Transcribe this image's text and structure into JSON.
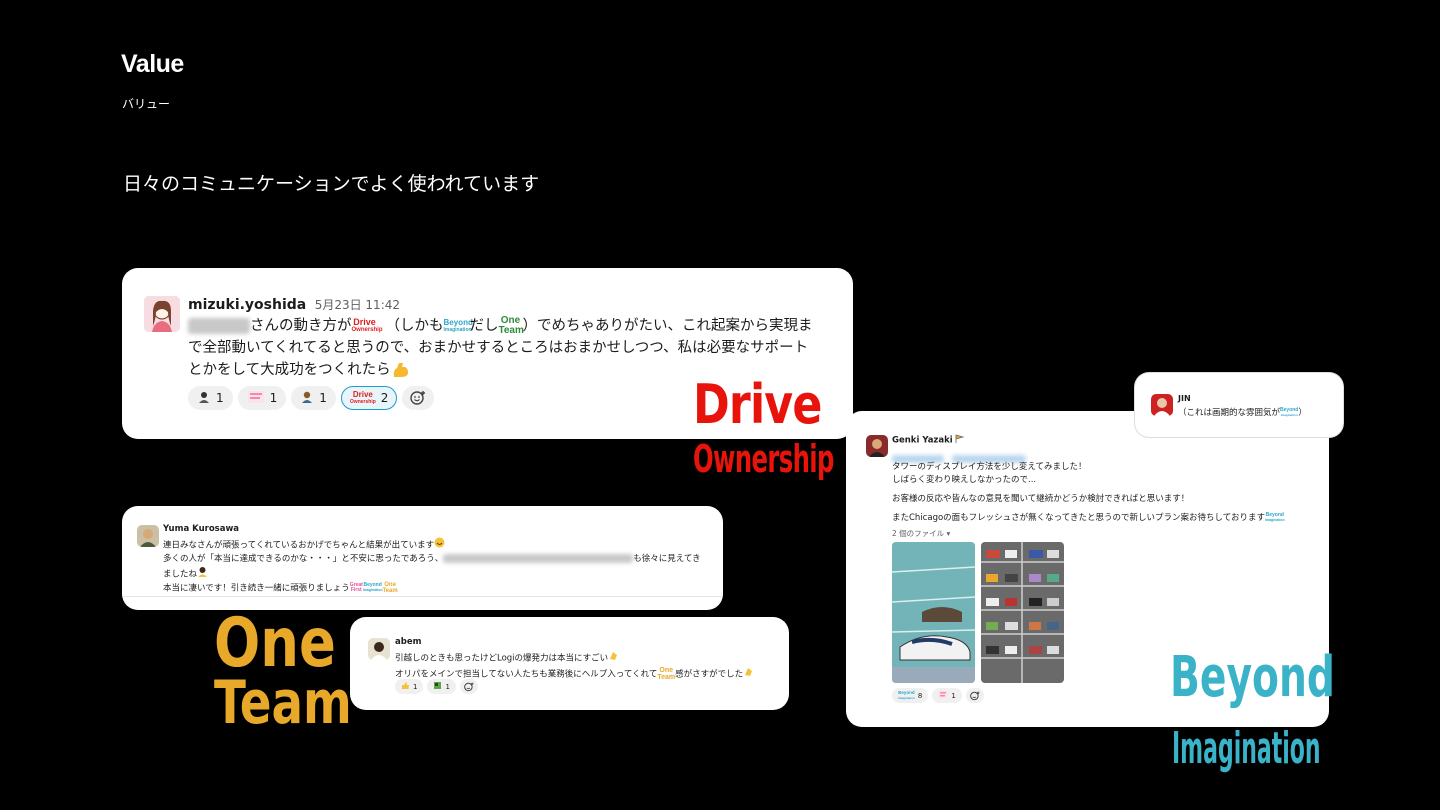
{
  "header": {
    "title": "Value",
    "subtitle": "バリュー",
    "headline": "日々のコミュニケーションでよく使われています"
  },
  "msg_mizuki": {
    "user": "mizuki.yoshida",
    "time": "5月23日 11:42",
    "text_1": "さんの動き方が",
    "text_2": "（しかも",
    "text_3": "だし",
    "text_4": "）でめちゃありがたい、これ起案から実現ま",
    "text_5": "で全部動いてくれてると思うので、おまかせするところはおまかせしつつ、私は必要なサポート",
    "text_6": "とかをして大成功をつくれたら",
    "reactions": [
      {
        "emoji": "person-icon",
        "count": "1"
      },
      {
        "emoji": "pink-stamp-icon",
        "count": "1"
      },
      {
        "emoji": "person-dark-icon",
        "count": "1"
      },
      {
        "emoji": "drive-ownership-icon",
        "count": "2"
      }
    ]
  },
  "msg_yuma": {
    "user": "Yuma Kurosawa",
    "line_1": "連日みなさんが頑張ってくれているおかげでちゃんと結果が出ています",
    "line_2a": "多くの人が「本当に達成できるのかな・・・」と不安に思ったであろう、",
    "line_2b": "も徐々に見えてき",
    "line_3": "ましたね",
    "line_4": "本当に凄いです！引き続き一緒に頑張りましょう"
  },
  "msg_abem": {
    "user": "abem",
    "line_1": "引越しのときも思ったけどLogiの爆発力は本当にすごい",
    "line_2a": "オリパをメインで担当してない人たちも業務後にヘルプ入ってくれて",
    "line_2b": "感がさすがでした",
    "reactions": [
      {
        "emoji": "thumbs-up-icon",
        "count": "1"
      },
      {
        "emoji": "green-stamp-icon",
        "count": "1"
      }
    ]
  },
  "msg_genki": {
    "user": "Genki Yazaki",
    "line_1": "タワーのディスプレイ方法を少し変えてみました！",
    "line_2": "しばらく変わり映えしなかったので...",
    "line_3": "お客様の反応や皆んなの意見を聞いて継続かどうか検討できればと思います！",
    "line_4": "またChicagoの面もフレッシュさが無くなってきたと思うので新しいプラン案お待ちしております",
    "files_label": "2 個のファイル",
    "reactions": [
      {
        "emoji": "beyond-imagination-icon",
        "count": "8"
      },
      {
        "emoji": "pink-stamp-icon",
        "count": "1"
      }
    ]
  },
  "msg_jin": {
    "user": "JIN",
    "text": "（これは画期的な雰囲気が"
  },
  "overlay_labels": {
    "drive": "Drive",
    "ownership": "Ownership",
    "one": "One",
    "team": "Team",
    "beyond": "Beyond",
    "imagination": "Imagination"
  },
  "mini_emoji": {
    "drive": "Drive",
    "ownership": "Ownership",
    "beyond": "Beyond",
    "imagination": "Imagination",
    "one": "One",
    "team": "Team",
    "great": "Great",
    "first": "First"
  },
  "colors": {
    "drive": "#e8140c",
    "one_team": "#e8a82a",
    "beyond": "#3ab3c8",
    "active_reaction": "#1d9bd1"
  }
}
